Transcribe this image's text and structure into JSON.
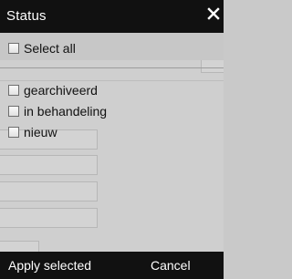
{
  "dialog": {
    "title": "Status",
    "close_icon": "close-icon"
  },
  "select_all": {
    "label": "Select all",
    "checked": false
  },
  "options": [
    {
      "label": "gearchiveerd",
      "checked": false
    },
    {
      "label": "in behandeling",
      "checked": false
    },
    {
      "label": "nieuw",
      "checked": false
    }
  ],
  "footer": {
    "apply_label": "Apply selected",
    "cancel_label": "Cancel"
  },
  "colors": {
    "titlebar": "#111111",
    "panel": "#cfcfcf",
    "text": "#111111"
  }
}
